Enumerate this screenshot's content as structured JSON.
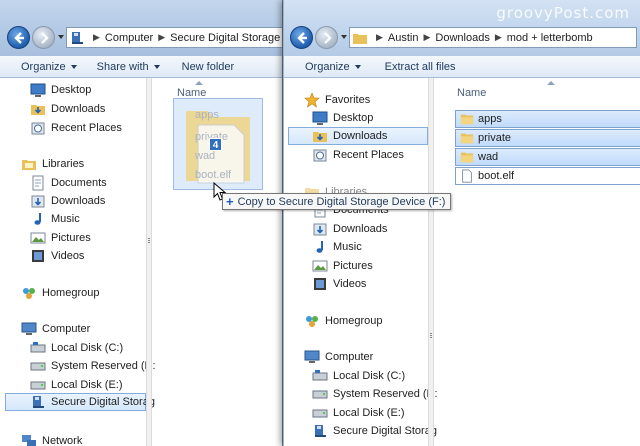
{
  "watermark": "groovyPost.com",
  "left_window": {
    "address": [
      "Computer",
      "Secure Digital Storage D"
    ],
    "toolbar": {
      "organize": "Organize",
      "share_with": "Share with",
      "new_folder": "New folder"
    },
    "nav": {
      "desktop": "Desktop",
      "downloads": "Downloads",
      "recent_places": "Recent Places",
      "libraries": "Libraries",
      "documents": "Documents",
      "lib_downloads": "Downloads",
      "music": "Music",
      "pictures": "Pictures",
      "videos": "Videos",
      "homegroup": "Homegroup",
      "computer": "Computer",
      "local_c": "Local Disk (C:)",
      "system_reserved": "System Reserved (D:",
      "local_e": "Local Disk (E:)",
      "sd_storage": "Secure Digital Storag",
      "network": "Network"
    },
    "column_name": "Name"
  },
  "drag": {
    "ghost_items": [
      "apps",
      "private",
      "wad",
      "boot.elf"
    ],
    "badge": "4",
    "tooltip": "Copy to Secure Digital Storage Device (F:)"
  },
  "right_window": {
    "address": [
      "Austin",
      "Downloads",
      "mod + letterbomb"
    ],
    "toolbar": {
      "organize": "Organize",
      "extract_all": "Extract all files"
    },
    "nav": {
      "favorites": "Favorites",
      "desktop": "Desktop",
      "downloads": "Downloads",
      "recent_places": "Recent Places",
      "libraries": "Libraries",
      "documents": "Documents",
      "lib_downloads": "Downloads",
      "music": "Music",
      "pictures": "Pictures",
      "videos": "Videos",
      "homegroup": "Homegroup",
      "computer": "Computer",
      "local_c": "Local Disk (C:)",
      "system_reserved": "System Reserved (D:",
      "local_e": "Local Disk (E:)",
      "sd_storage": "Secure Digital Storag"
    },
    "column_name": "Name",
    "files": [
      "apps",
      "private",
      "wad",
      "boot.elf"
    ]
  },
  "colors": {
    "selection_fill": "#c9e0fb",
    "selection_border": "#7da2ce",
    "folder": "#e9c15a"
  }
}
